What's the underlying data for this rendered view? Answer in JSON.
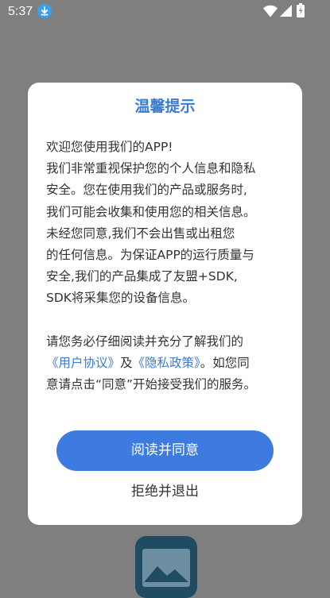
{
  "status_bar": {
    "time": "5:37",
    "icons": [
      "download-icon",
      "wifi-icon",
      "signal-icon",
      "battery-icon"
    ]
  },
  "dialog": {
    "title": "温馨提示",
    "paragraph1": [
      "欢迎您使用我们的APP!",
      "我们非常重视保护您的个人信息和隐私",
      "安全。您在使用我们的产品或服务时,",
      "我们可能会收集和使用您的相关信息。",
      "未经您同意,我们不会出售或出租您",
      "的任何信息。为保证APP的运行质量与",
      "安全,我们的产品集成了友盟+SDK,",
      "SDK将采集您的设备信息。"
    ],
    "paragraph2_line1": "请您务必仔细阅读并充分了解我们的",
    "user_agreement_link": "《用户协议》",
    "and_text": "及",
    "privacy_policy_link": "《隐私政策》",
    "paragraph2_line2_tail": "。如您同",
    "paragraph2_line3": "意请点击“同意”开始接受我们的服务。",
    "agree_button": "阅读并同意",
    "reject_button": "拒绝并退出"
  },
  "colors": {
    "accent": "#3a7bd5",
    "button": "#3d7be0",
    "overlay": "#7f7f7f",
    "text": "#333333"
  }
}
